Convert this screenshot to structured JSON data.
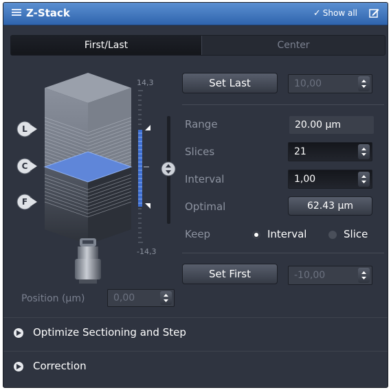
{
  "title": "Z-Stack",
  "title_icon": "list-icon",
  "show_all": {
    "check": "✓",
    "label": "Show all"
  },
  "edit_icon": "edit-icon",
  "tabs": {
    "first_last": "First/Last",
    "center": "Center"
  },
  "stack": {
    "scale_top": "14,3",
    "scale_bottom": "-14,3",
    "markers": {
      "last": "L",
      "center": "C",
      "first": "F"
    },
    "objective_icon": "objective-icon"
  },
  "set_last": {
    "label": "Set Last",
    "value": "10,00"
  },
  "range": {
    "label": "Range",
    "value": "20.00 µm"
  },
  "slices": {
    "label": "Slices",
    "value": "21"
  },
  "interval": {
    "label": "Interval",
    "value": "1,00"
  },
  "optimal": {
    "label": "Optimal",
    "button": "62.43 µm"
  },
  "keep": {
    "label": "Keep",
    "option_interval": "Interval",
    "option_slice": "Slice",
    "selected": "Interval"
  },
  "set_first": {
    "label": "Set First",
    "value": "-10,00"
  },
  "position": {
    "label": "Position (µm)",
    "value": "0,00"
  },
  "sections": {
    "optimize": "Optimize Sectioning and Step",
    "correction": "Correction"
  },
  "colors": {
    "accent_blue": "#3f6fd1",
    "titlebar": "#3e74bf",
    "panel": "#2f3440"
  }
}
